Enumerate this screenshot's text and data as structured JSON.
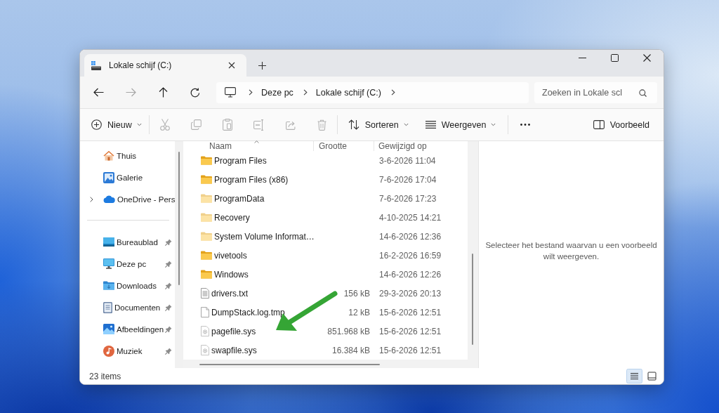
{
  "tabs": [
    {
      "label": "Lokale schijf (C:)",
      "selected": true
    }
  ],
  "navigation": {
    "buttons": [
      {
        "disabled": false
      },
      {
        "disabled": true
      },
      {
        "disabled": false
      },
      {
        "disabled": false
      }
    ]
  },
  "address": {
    "segments": [
      "Deze pc",
      "Lokale schijf (C:)"
    ]
  },
  "search": {
    "placeholder": "Zoeken in Lokale scl"
  },
  "toolbar": {
    "new_label": "Nieuw",
    "actions": [
      {
        "disabled": true
      },
      {
        "disabled": true
      },
      {
        "disabled": true
      },
      {
        "disabled": true
      },
      {
        "disabled": true
      },
      {
        "disabled": true
      }
    ],
    "sort_label": "Sorteren",
    "view_label": "Weergeven",
    "preview_label": "Voorbeeld"
  },
  "sidebar": {
    "top_items": [
      {
        "label": "Thuis",
        "expandable": false
      },
      {
        "label": "Galerie",
        "expandable": false
      },
      {
        "label": "OneDrive - Pers",
        "expandable": true
      }
    ],
    "quick_access": [
      {
        "label": "Bureaublad",
        "pinned": true
      },
      {
        "label": "Deze pc",
        "pinned": true
      },
      {
        "label": "Downloads",
        "pinned": true
      },
      {
        "label": "Documenten",
        "pinned": true
      },
      {
        "label": "Afbeeldingen",
        "pinned": true
      },
      {
        "label": "Muziek",
        "pinned": true
      }
    ]
  },
  "file_list": {
    "columns": [
      {
        "label": "Naam",
        "sorted": true
      },
      {
        "label": "Grootte",
        "sorted": false
      },
      {
        "label": "Gewijzigd op",
        "sorted": false
      }
    ],
    "rows": [
      {
        "name": "Program Files",
        "kind": "folder",
        "hidden": false,
        "modified": "3-6-2026 11:04"
      },
      {
        "name": "Program Files (x86)",
        "kind": "folder",
        "hidden": false,
        "modified": "7-6-2026 17:04"
      },
      {
        "name": "ProgramData",
        "kind": "folder",
        "hidden": true,
        "modified": "7-6-2026 17:23"
      },
      {
        "name": "Recovery",
        "kind": "folder",
        "hidden": true,
        "modified": "4-10-2025 14:21"
      },
      {
        "name": "System Volume Informat…",
        "kind": "folder",
        "hidden": true,
        "modified": "14-6-2026 12:36"
      },
      {
        "name": "vivetools",
        "kind": "folder",
        "hidden": false,
        "modified": "16-2-2026 16:59"
      },
      {
        "name": "Windows",
        "kind": "folder",
        "hidden": false,
        "modified": "14-6-2026 12:26"
      },
      {
        "name": "drivers.txt",
        "kind": "text",
        "hidden": false,
        "size": "156 kB",
        "modified": "29-3-2026 20:13"
      },
      {
        "name": "DumpStack.log.tmp",
        "kind": "file",
        "hidden": false,
        "size": "12 kB",
        "modified": "15-6-2026 12:51"
      },
      {
        "name": "pagefile.sys",
        "kind": "system",
        "hidden": true,
        "size": "851.968 kB",
        "modified": "15-6-2026 12:51"
      },
      {
        "name": "swapfile.sys",
        "kind": "system",
        "hidden": true,
        "size": "16.384 kB",
        "modified": "15-6-2026 12:51"
      }
    ]
  },
  "preview": {
    "message": "Selecteer het bestand waarvan u een voorbeeld wilt weergeven."
  },
  "status_bar": {
    "item_count": "23 items",
    "views": [
      {
        "selected": true
      },
      {
        "selected": false
      }
    ]
  }
}
